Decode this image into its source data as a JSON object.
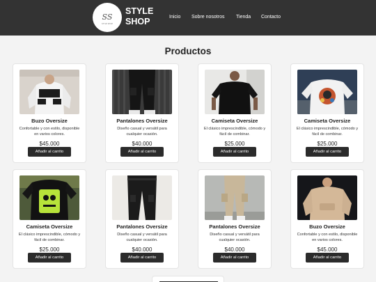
{
  "brand": {
    "logo_monogram": "SS",
    "line1": "STYLE",
    "line2": "SHOP"
  },
  "nav": [
    "Inicio",
    "Sobre nosotros",
    "Tienda",
    "Contacto"
  ],
  "page_title": "Productos",
  "products": [
    {
      "title": "Buzo Oversize",
      "desc": "Confortable y con estilo, disponible en varios colores.",
      "price": "$45.000",
      "button": "Añadir al carrito"
    },
    {
      "title": "Pantalones Oversize",
      "desc": "Diseño casual y versátil para cualquier ocasión.",
      "price": "$40.000",
      "button": "Añadir al carrito"
    },
    {
      "title": "Camiseta Oversize",
      "desc": "El clásico imprescindible, cómodo y fácil de combinar.",
      "price": "$25.000",
      "button": "Añadir al carrito"
    },
    {
      "title": "Camiseta Oversize",
      "desc": "El clásico imprescindible, cómodo y fácil de combinar.",
      "price": "$25.000",
      "button": "Añadir al carrito"
    },
    {
      "title": "Camiseta Oversize",
      "desc": "El clásico imprescindible, cómodo y fácil de combinar.",
      "price": "$25.000",
      "button": "Añadir al carrito"
    },
    {
      "title": "Pantalones Oversize",
      "desc": "Diseño casual y versátil para cualquier ocasión.",
      "price": "$40.000",
      "button": "Añadir al carrito"
    },
    {
      "title": "Pantalones Oversize",
      "desc": "Diseño casual y versátil para cualquier ocasión.",
      "price": "$40.000",
      "button": "Añadir al carrito"
    },
    {
      "title": "Buzo Oversize",
      "desc": "Confortable y con estilo, disponible en varios colores.",
      "price": "$45.000",
      "button": "Añadir al carrito"
    }
  ],
  "colors": {
    "navbar": "#333333",
    "button": "#2b2b2b",
    "page_bg": "#f3f3f3"
  }
}
